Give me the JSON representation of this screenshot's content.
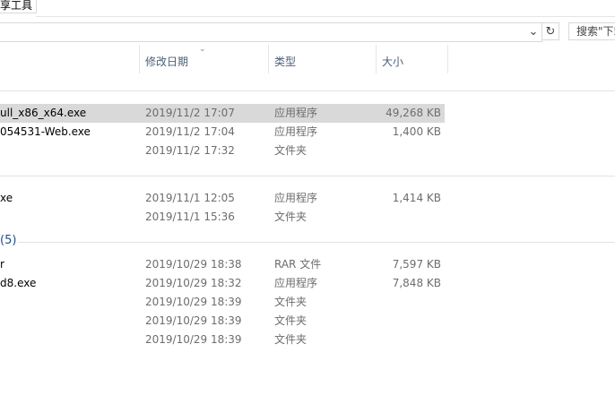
{
  "ribbon": {
    "tab_label": "享工具"
  },
  "address": {
    "dropdown_glyph": "⌄",
    "refresh_glyph": "↻",
    "search_placeholder": "搜索\"下载\""
  },
  "columns": {
    "date": "修改日期",
    "type": "类型",
    "size": "大小",
    "sort_glyph": "⌄"
  },
  "group_label": "(5)",
  "rows": [
    {
      "name": "ull_x86_x64.exe",
      "date": "2019/11/2 17:07",
      "type": "应用程序",
      "size": "49,268 KB"
    },
    {
      "name": "054531-Web.exe",
      "date": "2019/11/2 17:04",
      "type": "应用程序",
      "size": "1,400 KB"
    },
    {
      "name": "",
      "date": "2019/11/2 17:32",
      "type": "文件夹",
      "size": ""
    },
    {
      "name": "xe",
      "date": "2019/11/1 12:05",
      "type": "应用程序",
      "size": "1,414 KB"
    },
    {
      "name": "",
      "date": "2019/11/1 15:36",
      "type": "文件夹",
      "size": ""
    },
    {
      "name": "r",
      "date": "2019/10/29 18:38",
      "type": "RAR 文件",
      "size": "7,597 KB"
    },
    {
      "name": "d8.exe",
      "date": "2019/10/29 18:32",
      "type": "应用程序",
      "size": "7,848 KB"
    },
    {
      "name": "",
      "date": "2019/10/29 18:39",
      "type": "文件夹",
      "size": ""
    },
    {
      "name": "",
      "date": "2019/10/29 18:39",
      "type": "文件夹",
      "size": ""
    },
    {
      "name": "",
      "date": "2019/10/29 18:39",
      "type": "文件夹",
      "size": ""
    }
  ]
}
